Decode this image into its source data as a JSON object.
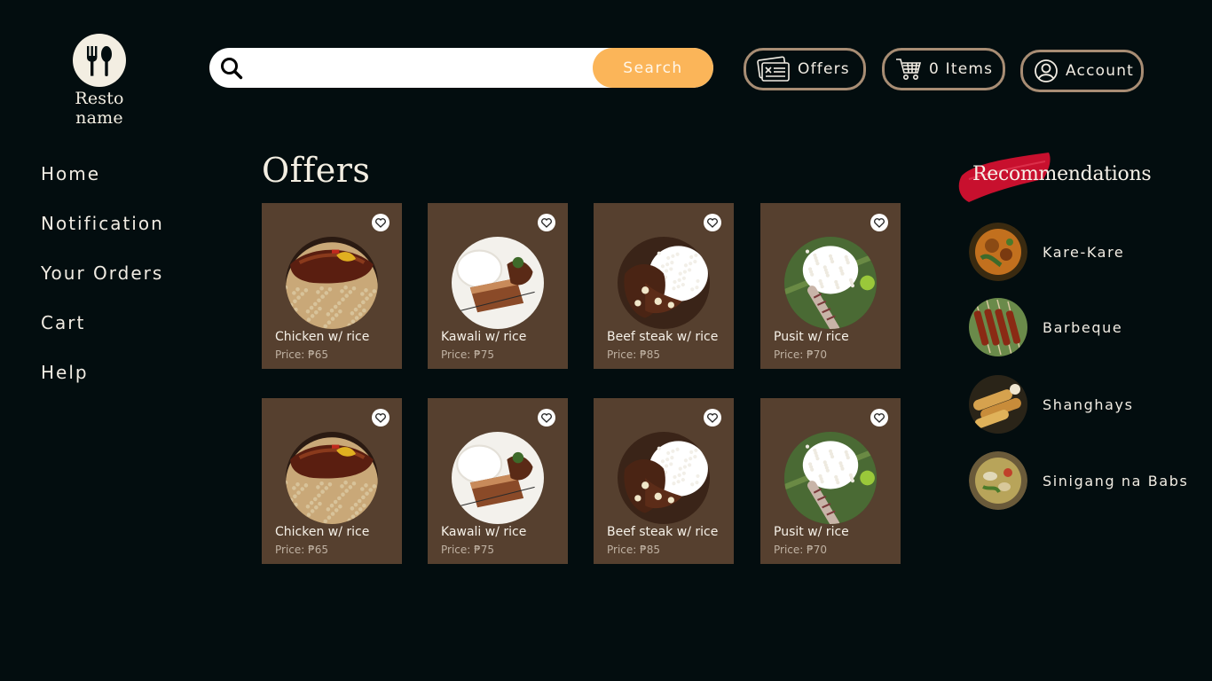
{
  "brand": {
    "name": "Resto name",
    "logo_icon": "fork-spoon-icon"
  },
  "search": {
    "placeholder": "",
    "value": "",
    "button_label": "Search",
    "button_color": "#fbb559"
  },
  "header": {
    "offers_label": "Offers",
    "cart_label": "0 Items",
    "account_label": "Account"
  },
  "nav": {
    "items": [
      {
        "label": "Home"
      },
      {
        "label": "Notification"
      },
      {
        "label": "Your Orders"
      },
      {
        "label": "Cart"
      },
      {
        "label": "Help"
      }
    ]
  },
  "offers": {
    "title": "Offers",
    "rows": [
      [
        {
          "name": "Chicken w/ rice",
          "price": "Price: ₱65",
          "image": "chicken"
        },
        {
          "name": "Kawali w/ rice",
          "price": "Price: ₱75",
          "image": "kawali"
        },
        {
          "name": "Beef steak w/ rice",
          "price": "Price: ₱85",
          "image": "beef"
        },
        {
          "name": "Pusit w/ rice",
          "price": "Price: ₱70",
          "image": "pusit"
        }
      ],
      [
        {
          "name": "Chicken w/ rice",
          "price": "Price: ₱65",
          "image": "chicken"
        },
        {
          "name": "Kawali w/ rice",
          "price": "Price: ₱75",
          "image": "kawali"
        },
        {
          "name": "Beef steak w/ rice",
          "price": "Price: ₱85",
          "image": "beef"
        },
        {
          "name": "Pusit w/ rice",
          "price": "Price: ₱70",
          "image": "pusit"
        }
      ]
    ]
  },
  "recommendations": {
    "title": "Recommendations",
    "items": [
      {
        "name": "Kare-Kare",
        "image": "karekare"
      },
      {
        "name": "Barbeque",
        "image": "barbeque"
      },
      {
        "name": "Shanghays",
        "image": "shanghay"
      },
      {
        "name": "Sinigang na Babs",
        "image": "sinigang"
      }
    ]
  },
  "colors": {
    "background": "#030d0f",
    "card": "#56402f",
    "pill_border": "#a88d74",
    "accent_red": "#c8102e"
  }
}
